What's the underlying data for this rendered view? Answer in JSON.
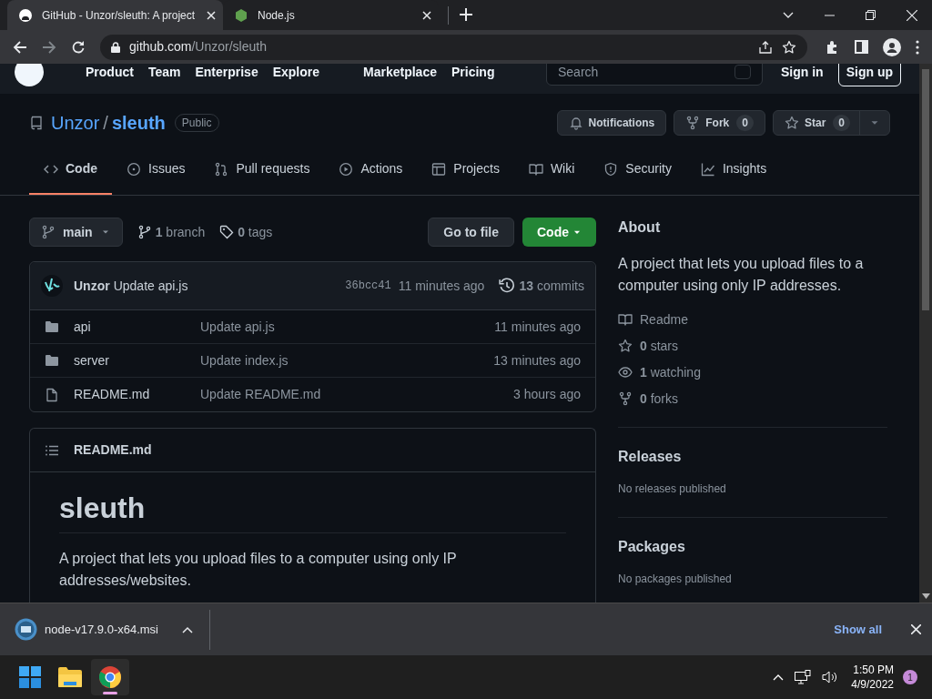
{
  "browser": {
    "tabs": [
      {
        "title": "GitHub - Unzor/sleuth: A project",
        "selected": true
      },
      {
        "title": "Node.js",
        "selected": false
      }
    ],
    "address": {
      "host": "github.com",
      "path": "/Unzor/sleuth"
    }
  },
  "site_header": {
    "nav": [
      "Product",
      "Team",
      "Enterprise",
      "Explore",
      "Marketplace",
      "Pricing"
    ],
    "search": {
      "placeholder": "Search"
    },
    "sign_in": "Sign in",
    "sign_up": "Sign up"
  },
  "repo": {
    "owner": "Unzor",
    "separator": "/",
    "name": "sleuth",
    "visibility": "Public",
    "actions": [
      {
        "kind": "bell",
        "label": "Notifications"
      },
      {
        "kind": "fork",
        "label": "Fork",
        "count": "0"
      },
      {
        "kind": "star",
        "label": "Star",
        "count": "0",
        "dropdown": true
      }
    ]
  },
  "tabs": [
    {
      "kind": "code",
      "label": "Code",
      "selected": true
    },
    {
      "kind": "issue",
      "label": "Issues",
      "selected": false
    },
    {
      "kind": "pr",
      "label": "Pull requests",
      "selected": false
    },
    {
      "kind": "play",
      "label": "Actions",
      "selected": false
    },
    {
      "kind": "table",
      "label": "Projects",
      "selected": false
    },
    {
      "kind": "book",
      "label": "Wiki",
      "selected": false
    },
    {
      "kind": "shield",
      "label": "Security",
      "selected": false
    },
    {
      "kind": "graph",
      "label": "Insights",
      "selected": false
    }
  ],
  "toolbar": {
    "branch": "main",
    "branches": "**1** branch",
    "tags": "**0** tags",
    "go_to_file": "Go to file",
    "code_button": "Code"
  },
  "commit": {
    "author": "Unzor",
    "message": "Update api.js",
    "sha": "36bcc41",
    "time": "11 minutes ago",
    "commits": "**13** commits"
  },
  "files": [
    {
      "kind": "folder",
      "name": "api",
      "message": "Update api.js",
      "time": "11 minutes ago"
    },
    {
      "kind": "folder",
      "name": "server",
      "message": "Update index.js",
      "time": "13 minutes ago"
    },
    {
      "kind": "file",
      "name": "README.md",
      "message": "Update README.md",
      "time": "3 hours ago"
    }
  ],
  "readme": {
    "file": "README.md",
    "title": "sleuth",
    "text": "A project that lets you upload files to a computer using only IP addresses/websites."
  },
  "about": {
    "heading": "About",
    "description": "A project that lets you upload files to a computer using only IP addresses.",
    "links": [
      {
        "kind": "book",
        "label": "Readme"
      },
      {
        "kind": "star",
        "label": "**0** stars"
      },
      {
        "kind": "eye",
        "label": "**1** watching"
      },
      {
        "kind": "fork",
        "label": "**0** forks"
      }
    ]
  },
  "releases": {
    "heading": "Releases",
    "text": "No releases published"
  },
  "packages": {
    "heading": "Packages",
    "text": "No packages published"
  },
  "download_bar": {
    "file": "node-v17.9.0-x64.msi",
    "show_all": "Show all"
  },
  "taskbar": {
    "apps": [
      {
        "kind": "windows",
        "selected": false
      },
      {
        "kind": "folder",
        "selected": false
      },
      {
        "kind": "browser",
        "selected": true
      }
    ],
    "time": "1:50 PM",
    "date": "4/9/2022",
    "badge": "1"
  }
}
